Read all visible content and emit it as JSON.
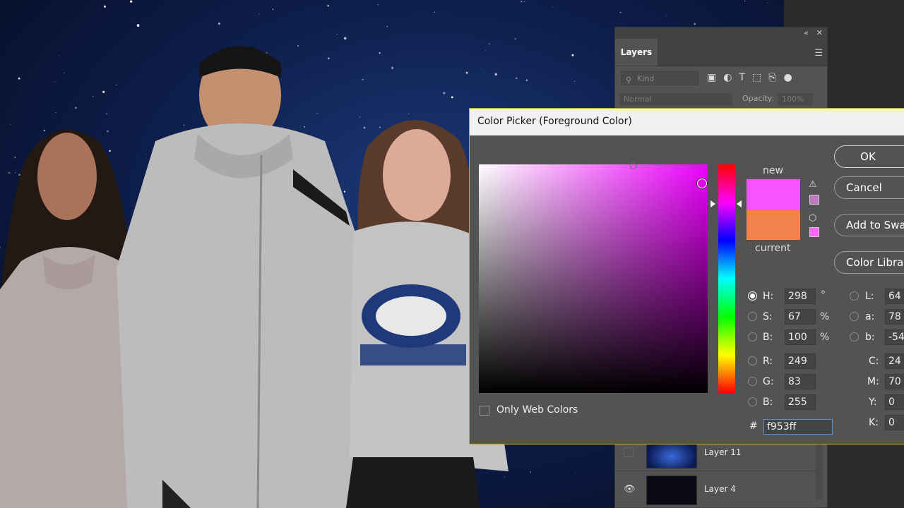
{
  "layers_panel": {
    "tab": "Layers",
    "search_placeholder": "Kind",
    "blend_mode": "Normal",
    "opacity_label": "Opacity:",
    "opacity_value": "100%",
    "layers": [
      {
        "name": "Layer 11",
        "visible": false
      },
      {
        "name": "Layer 4",
        "visible": true
      }
    ]
  },
  "color_picker": {
    "title": "Color Picker (Foreground Color)",
    "new_label": "new",
    "current_label": "current",
    "new_color": "#f953ff",
    "current_color": "#f4824f",
    "buttons": {
      "ok": "OK",
      "cancel": "Cancel",
      "add_to_swatches": "Add to Swatches",
      "color_libraries": "Color Libraries"
    },
    "only_web_colors": "Only Web Colors",
    "hsb": {
      "h": "298",
      "s": "67",
      "b": "100",
      "h_unit": "°",
      "s_unit": "%",
      "b_unit": "%"
    },
    "rgb": {
      "r": "249",
      "g": "83",
      "b": "255"
    },
    "lab": {
      "l": "64",
      "a": "78",
      "b": "-54"
    },
    "cmyk": {
      "c": "24",
      "m": "70",
      "y": "0",
      "k": "0"
    },
    "labels": {
      "h": "H:",
      "s": "S:",
      "bri": "B:",
      "r": "R:",
      "g": "G:",
      "b": "B:",
      "l": "L:",
      "a": "a:",
      "lab_b": "b:",
      "c": "C:",
      "m": "M:",
      "y": "Y:",
      "k": "K:",
      "hash": "#"
    },
    "hex": "f953ff"
  }
}
